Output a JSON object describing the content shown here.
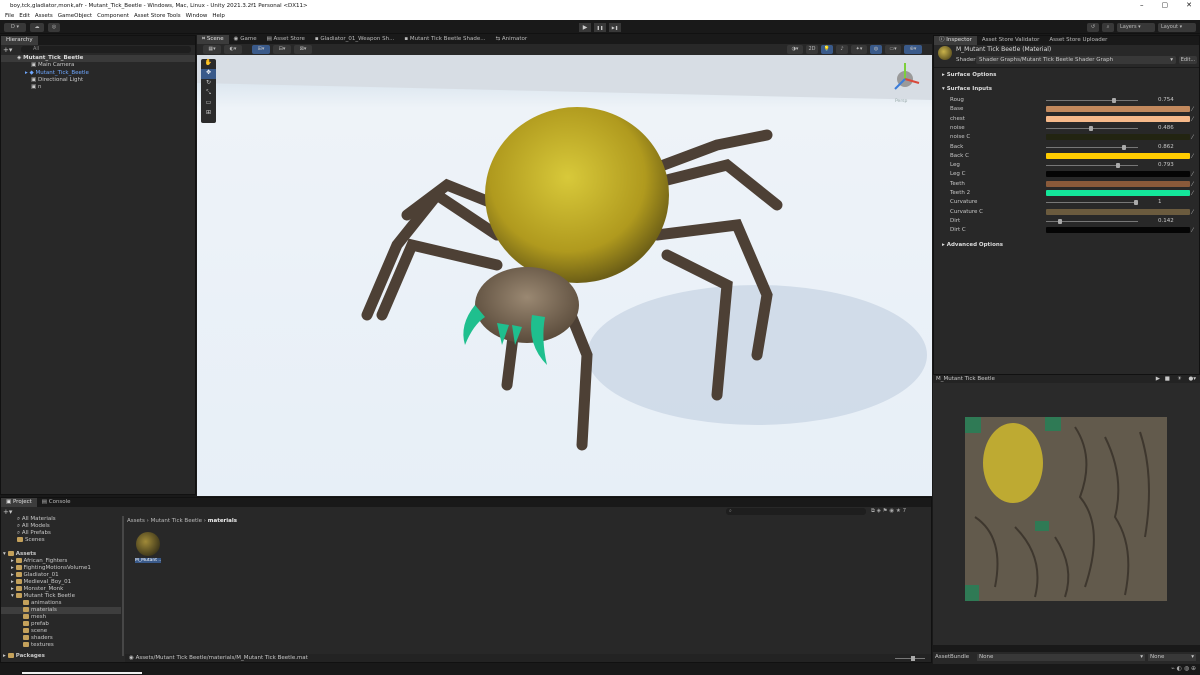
{
  "window": {
    "title": "boy,tck,gladiator,monk,afr - Mutant_Tick_Beetle - Windows, Mac, Linux - Unity 2021.3.2f1 Personal <DX11>",
    "controls": [
      "–",
      "▢",
      "✕"
    ]
  },
  "menu": [
    "File",
    "Edit",
    "Assets",
    "GameObject",
    "Component",
    "Asset Store Tools",
    "Window",
    "Help"
  ],
  "toolbar": {
    "account": "D ▾",
    "play": "▶",
    "pause": "❚❚",
    "step": "▶❚",
    "layers": "Layers",
    "layout": "Layout"
  },
  "hierarchy": {
    "tab": "Hierarchy",
    "search_placeholder": "All",
    "scene": "Mutant_Tick_Beetle",
    "items": [
      "Main Camera",
      "Mutant_Tick_Beetle",
      "Directional Light",
      "n"
    ]
  },
  "scene_tabs": [
    "Scene",
    "Game",
    "Asset Store",
    "Gladiator_01_Weapon Sh...",
    "Mutant Tick Beetle Shade...",
    "Animator"
  ],
  "gizmo": {
    "label": "Persp"
  },
  "inspector": {
    "tabs": [
      "Inspector",
      "Asset Store Validator",
      "Asset Store Uploader"
    ],
    "material_name": "M_Mutant Tick Beetle (Material)",
    "shader_label": "Shader",
    "shader_value": "Shader Graphs/Mutant Tick Beetle Shader Graph",
    "edit_button": "Edit...",
    "surface_options": "Surface Options",
    "surface_inputs": "Surface Inputs",
    "advanced_options": "Advanced Options",
    "properties": [
      {
        "name": "Roug",
        "kind": "slider",
        "value": "0.754",
        "pos": 0.754
      },
      {
        "name": "Base",
        "kind": "color",
        "color": "#c2895d"
      },
      {
        "name": "chest",
        "kind": "color",
        "color": "#f6b98a"
      },
      {
        "name": "noise",
        "kind": "slider",
        "value": "0.486",
        "pos": 0.486
      },
      {
        "name": "noise C",
        "kind": "color",
        "color": "#222411"
      },
      {
        "name": "Back",
        "kind": "slider",
        "value": "0.862",
        "pos": 0.862
      },
      {
        "name": "Back C",
        "kind": "color",
        "color": "#ffcc00"
      },
      {
        "name": "Leg",
        "kind": "slider",
        "value": "0.793",
        "pos": 0.793
      },
      {
        "name": "Leg C",
        "kind": "color",
        "color": "#050505"
      },
      {
        "name": "Teeth",
        "kind": "color",
        "color": "#8a5a3a"
      },
      {
        "name": "Teeth 2",
        "kind": "color",
        "color": "#14e69a"
      },
      {
        "name": "Curvature",
        "kind": "slider",
        "value": "1",
        "pos": 1.0
      },
      {
        "name": "Curvature C",
        "kind": "color",
        "color": "#6b5b3e"
      },
      {
        "name": "Dirt",
        "kind": "slider",
        "value": "0.142",
        "pos": 0.142
      },
      {
        "name": "Dirt C",
        "kind": "color",
        "color": "#050505"
      }
    ]
  },
  "preview": {
    "title": "M_Mutant Tick Beetle"
  },
  "project": {
    "tabs": [
      "Project",
      "Console"
    ],
    "favorites": [
      "All Materials",
      "All Models",
      "All Prefabs",
      "Scenes"
    ],
    "assets_label": "Assets",
    "folders": [
      "African_Fighters",
      "FightingMotionsVolume1",
      "Gladiator_01",
      "Medieval_Boy_01",
      "Monster_Monk",
      "Mutant Tick Beetle"
    ],
    "subfolders": [
      "animations",
      "materials",
      "mesh",
      "prefab",
      "scene",
      "shaders",
      "textures"
    ],
    "packages_label": "Packages",
    "breadcrumb": [
      "Assets",
      "Mutant Tick Beetle",
      "materials"
    ],
    "asset_item": "M_Mutant ...",
    "path": "Assets/Mutant Tick Beetle/materials/M_Mutant Tick Beetle.mat",
    "count": "7"
  },
  "assetbundle": {
    "label": "AssetBundle",
    "value": "None",
    "variant": "None"
  }
}
